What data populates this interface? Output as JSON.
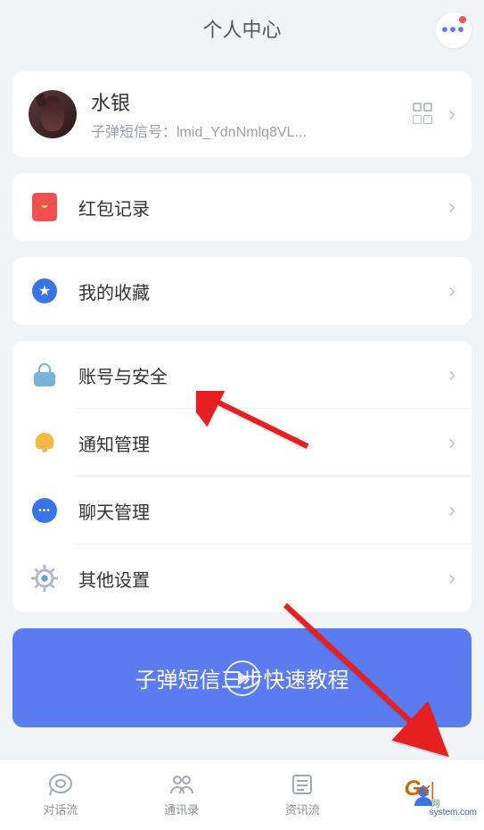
{
  "header": {
    "title": "个人中心"
  },
  "profile": {
    "name": "水银",
    "id_label": "子弹短信号：lmid_YdnNmlq8VL..."
  },
  "sections": {
    "redpacket": "红包记录",
    "favorites": "我的收藏",
    "security": "账号与安全",
    "notifications": "通知管理",
    "chat": "聊天管理",
    "other": "其他设置"
  },
  "banner": {
    "text": "子弹短信三步快速教程"
  },
  "tabs": {
    "chat": "对话流",
    "contacts": "通讯录",
    "feed": "资讯流"
  },
  "watermark": {
    "text": "GXI",
    "sub1": "网",
    "sub2": "system.com"
  }
}
